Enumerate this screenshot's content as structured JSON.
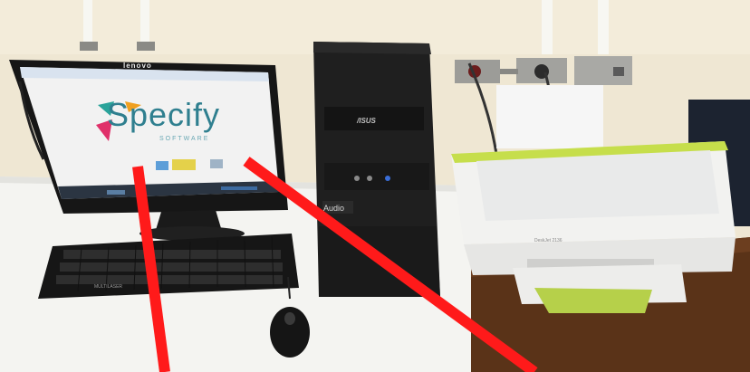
{
  "monitor": {
    "brand": "lenovo"
  },
  "screen": {
    "logo_text": "Specify",
    "logo_subtext": "SOFTWARE"
  },
  "tower": {
    "brand": "/ISUS",
    "front_label": "Audio"
  },
  "printer": {
    "brand": "DeskJet 2136"
  },
  "keyboard": {
    "brand": "MULTILASER"
  },
  "colors": {
    "annotation_line": "#ff1a1a",
    "wall": "#efe7d3",
    "printer_accent": "#c6de4b"
  }
}
